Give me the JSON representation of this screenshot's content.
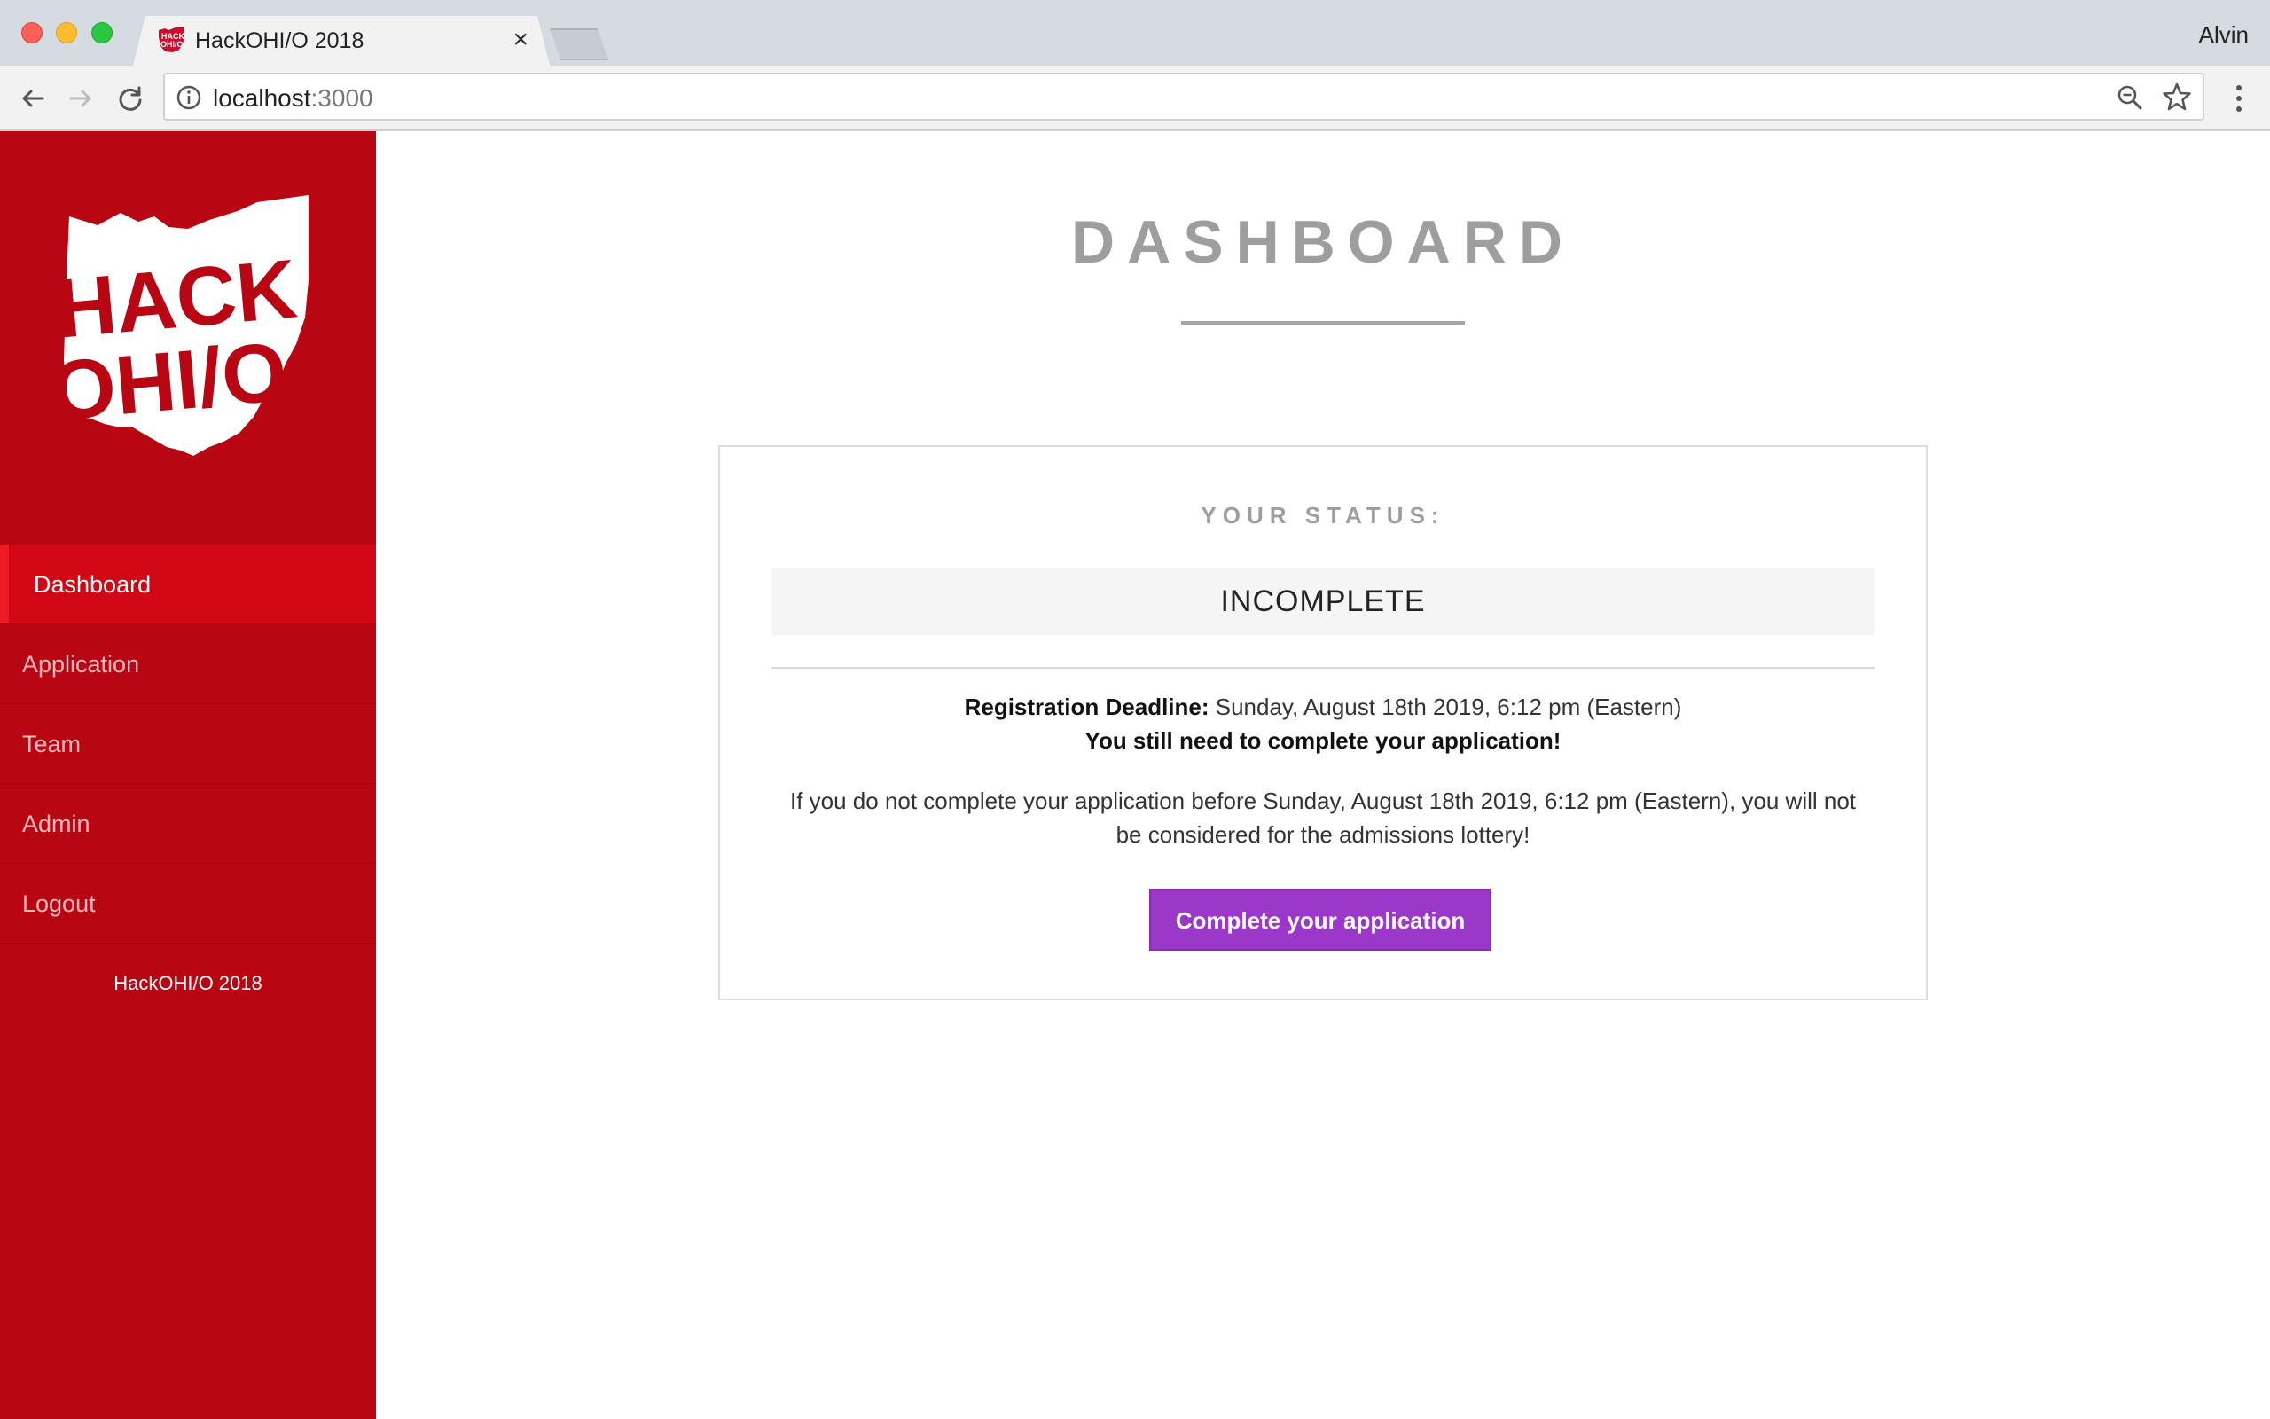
{
  "browser": {
    "tab_title": "HackOHI/O 2018",
    "tab_close": "×",
    "profile_name": "Alvin",
    "url_host": "localhost",
    "url_port": ":3000",
    "icons": {
      "back": "back-arrow-icon",
      "forward": "forward-arrow-icon",
      "reload": "reload-icon",
      "info": "info-icon",
      "zoom": "zoom-icon",
      "bookmark": "star-icon",
      "menu": "kebab-menu-icon"
    }
  },
  "sidebar": {
    "logo_text_top": "HACK",
    "logo_text_bottom": "OHI/O",
    "items": [
      {
        "label": "Dashboard",
        "active": true
      },
      {
        "label": "Application",
        "active": false
      },
      {
        "label": "Team",
        "active": false
      },
      {
        "label": "Admin",
        "active": false
      },
      {
        "label": "Logout",
        "active": false
      }
    ],
    "footer": "HackOHI/O 2018"
  },
  "main": {
    "title": "DASHBOARD",
    "status_heading": "YOUR STATUS:",
    "status_value": "INCOMPLETE",
    "deadline_label": "Registration Deadline:",
    "deadline_value": " Sunday, August 18th 2019, 6:12 pm (Eastern)",
    "incomplete_note": "You still need to complete your application!",
    "warning": "If you do not complete your application before Sunday, August 18th 2019, 6:12 pm (Eastern), you will not be considered for the admissions lottery!",
    "button_label": "Complete your application"
  },
  "colors": {
    "sidebar_bg": "#b80612",
    "sidebar_active": "#d10715",
    "button_bg": "#9b38c9",
    "title_gray": "#9e9e9e"
  }
}
